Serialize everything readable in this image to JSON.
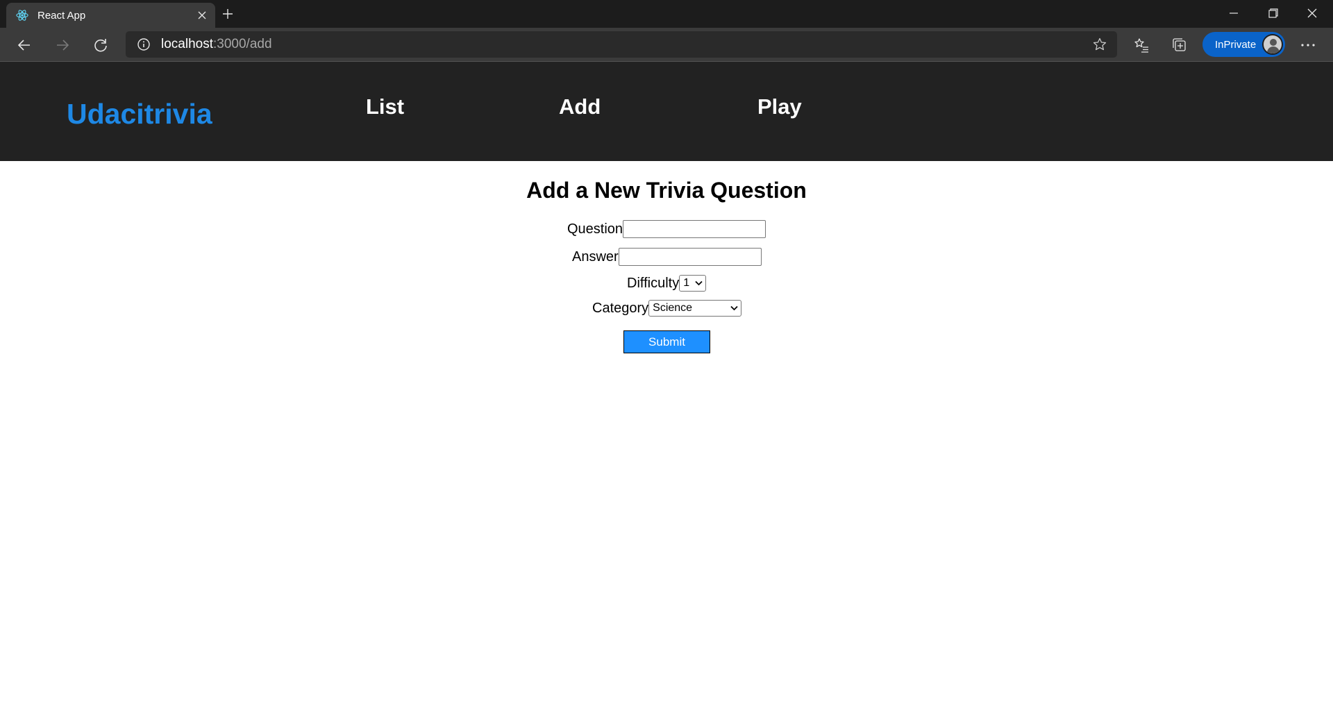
{
  "browser": {
    "tab_title": "React App",
    "url_host": "localhost",
    "url_path": ":3000/add",
    "inprivate_label": "InPrivate"
  },
  "app": {
    "brand": "Udacitrivia",
    "nav": [
      "List",
      "Add",
      "Play"
    ]
  },
  "form": {
    "title": "Add a New Trivia Question",
    "question_label": "Question",
    "question_value": "",
    "answer_label": "Answer",
    "answer_value": "",
    "difficulty_label": "Difficulty",
    "difficulty_value": "1",
    "category_label": "Category",
    "category_value": "Science",
    "submit_label": "Submit"
  },
  "icons": {
    "tab_favicon": "react-icon",
    "tab_close": "close-icon",
    "new_tab": "plus-icon",
    "minimize": "minimize-icon",
    "restore": "restore-icon",
    "window_close": "close-icon",
    "back": "back-arrow-icon",
    "forward": "forward-arrow-icon",
    "refresh": "refresh-icon",
    "site_info": "info-icon",
    "favorite": "star-icon",
    "favorites": "favorites-list-icon",
    "collections": "collections-icon",
    "profile": "avatar",
    "menu": "more-icon"
  },
  "colors": {
    "brand": "#1e88e5",
    "header_bg": "#222222",
    "submit_bg": "#1e90ff",
    "inprivate_bg": "#0a63c9"
  }
}
